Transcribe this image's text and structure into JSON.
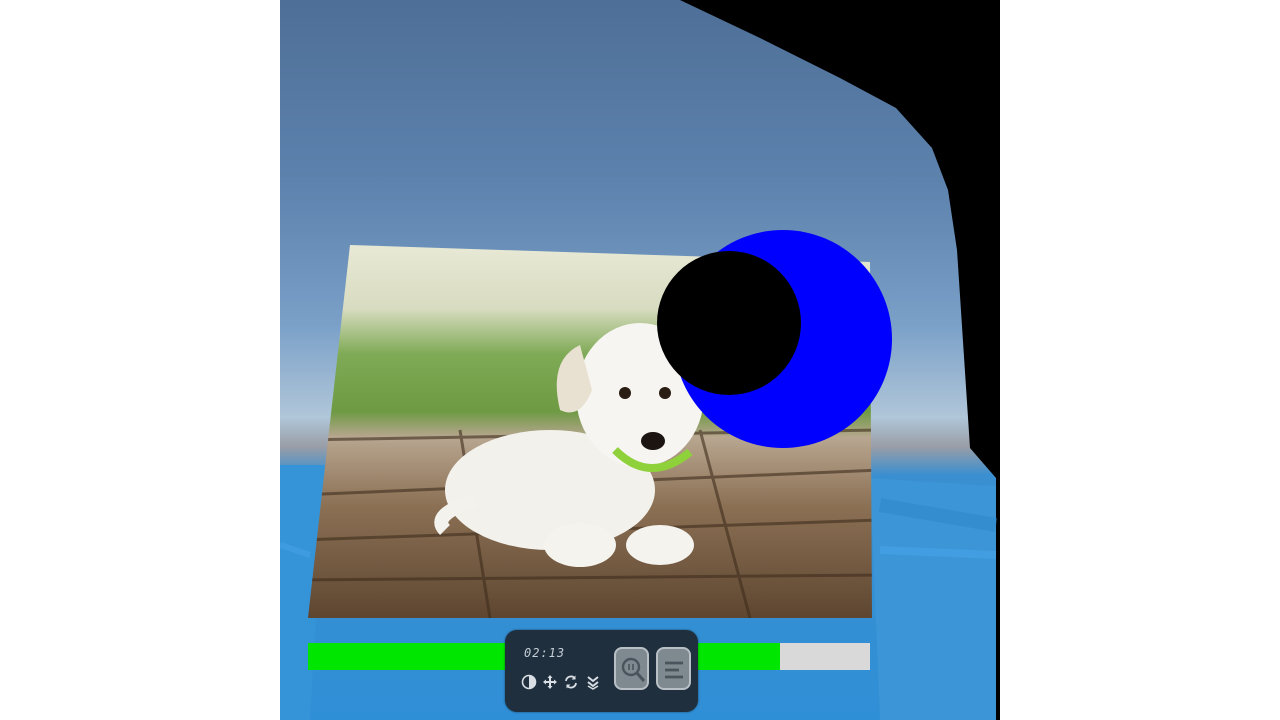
{
  "player": {
    "timestamp": "02:13",
    "progress_fraction": 0.84,
    "progress_fill_color": "#00e600",
    "progress_track_color": "#d9d9d9"
  },
  "controls": {
    "icons": [
      "contrast-icon",
      "move-icon",
      "rotate-icon",
      "layers-icon",
      "zoom-icon",
      "menu-icon"
    ]
  },
  "scene": {
    "photo_subject": "puppy-photo",
    "marker_outer_color": "#0000ff",
    "marker_inner_color": "#000000"
  }
}
